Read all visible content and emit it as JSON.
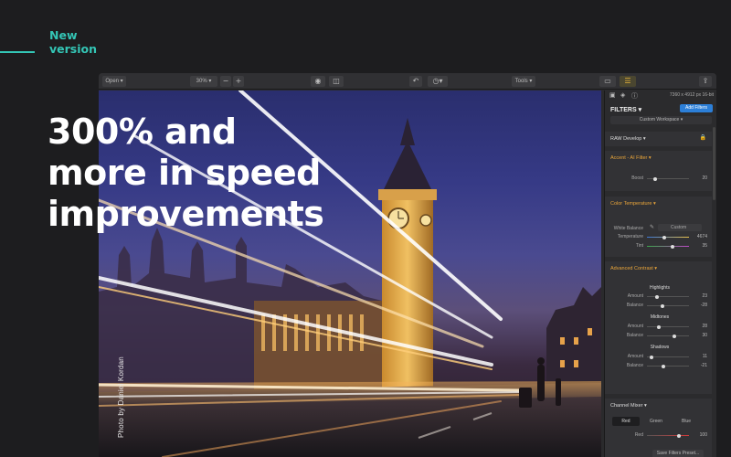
{
  "badge": {
    "line1": "New",
    "line2": "version",
    "accent": "#34c6b6"
  },
  "headline": {
    "line1": "300% and",
    "line2": "more in speed",
    "line3": "improvements"
  },
  "photo": {
    "credit": "Photo by Daniel Kordan"
  },
  "toolbar": {
    "open_label": "Open",
    "zoom_value": "30%",
    "zoom_out_icon": "minus-icon",
    "zoom_in_icon": "plus-icon",
    "tools_label": "Tools"
  },
  "panel": {
    "dimensions": "7360 x 4912 px   16-bit",
    "title": "FILTERS",
    "add_filters_label": "Add Filters",
    "workspace_label": "Custom Workspace",
    "raw_develop": "RAW Develop",
    "accent_ai": {
      "title": "Accent - AI Filter",
      "boost_label": "Boost",
      "boost_value": "20",
      "boost_level": 0.2
    },
    "color_temperature": {
      "title": "Color Temperature",
      "white_balance_label": "White Balance",
      "white_balance_value": "Custom",
      "temperature_label": "Temperature",
      "temperature_value": "4674",
      "temperature_level": 0.42,
      "tint_label": "Tint",
      "tint_value": "35",
      "tint_level": 0.6
    },
    "advanced_contrast": {
      "title": "Advanced Contrast",
      "highlights": {
        "title": "Highlights",
        "amount_label": "Amount",
        "amount_value": "23",
        "amount_level": 0.23,
        "balance_label": "Balance",
        "balance_value": "-28",
        "balance_level": 0.36
      },
      "midtones": {
        "title": "Midtones",
        "amount_label": "Amount",
        "amount_value": "28",
        "amount_level": 0.28,
        "balance_label": "Balance",
        "balance_value": "30",
        "balance_level": 0.65
      },
      "shadows": {
        "title": "Shadows",
        "amount_label": "Amount",
        "amount_value": "11",
        "amount_level": 0.11,
        "balance_label": "Balance",
        "balance_value": "-21",
        "balance_level": 0.39
      }
    },
    "channel_mixer": {
      "title": "Channel Mixer",
      "tabs": [
        "Red",
        "Green",
        "Blue"
      ],
      "active_tab": "Red",
      "red_label": "Red",
      "red_value": "100",
      "red_level": 0.75
    },
    "save_preset_label": "Save Filters Preset..."
  }
}
